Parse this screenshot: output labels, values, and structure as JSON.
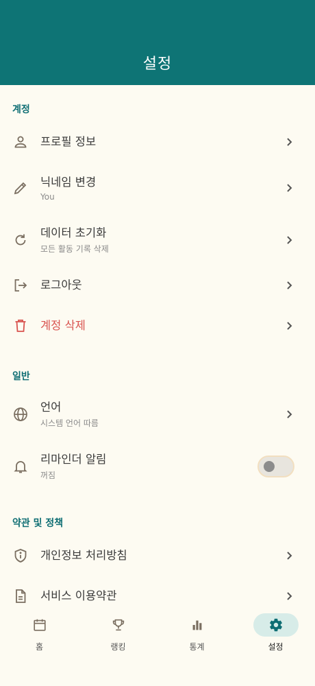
{
  "app_bar": {
    "title": "설정"
  },
  "sections": {
    "account": {
      "header": "계정",
      "profile": {
        "title": "프로필 정보",
        "icon": "person-icon"
      },
      "nickname": {
        "title": "닉네임 변경",
        "subtitle": "You",
        "icon": "pencil-icon"
      },
      "reset": {
        "title": "데이터 초기화",
        "subtitle": "모든 활동 기록 삭제",
        "icon": "refresh-icon"
      },
      "logout": {
        "title": "로그아웃",
        "icon": "logout-icon"
      },
      "delete": {
        "title": "계정 삭제",
        "icon": "trash-icon"
      }
    },
    "general": {
      "header": "일반",
      "language": {
        "title": "언어",
        "subtitle": "시스템 언어 따름",
        "icon": "globe-icon"
      },
      "reminder": {
        "title": "리마인더 알림",
        "subtitle": "꺼짐",
        "icon": "bell-icon",
        "enabled": false
      }
    },
    "policies": {
      "header": "약관 및 정책",
      "privacy": {
        "title": "개인정보 처리방침",
        "icon": "shield-info-icon"
      },
      "terms": {
        "title": "서비스 이용약관",
        "icon": "document-icon"
      }
    }
  },
  "bottom_nav": {
    "items": [
      {
        "label": "홈",
        "icon": "calendar-icon"
      },
      {
        "label": "랭킹",
        "icon": "trophy-icon"
      },
      {
        "label": "통계",
        "icon": "bar-chart-icon"
      },
      {
        "label": "설정",
        "icon": "gear-icon",
        "active": true
      }
    ]
  },
  "colors": {
    "primary": "#0E7475",
    "background": "#FDFBF2",
    "danger": "#D9534F",
    "nav_active_bg": "#D7ECE8"
  }
}
